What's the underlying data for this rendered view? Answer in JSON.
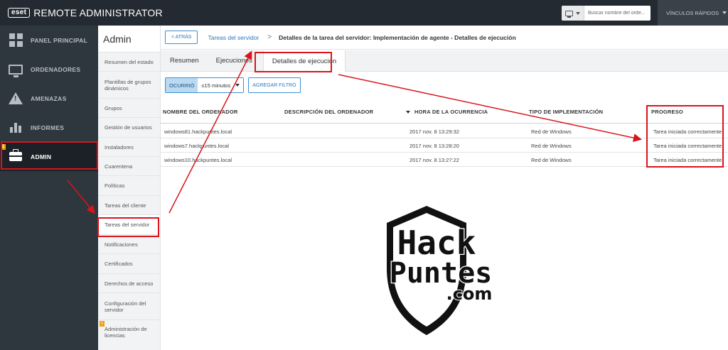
{
  "topbar": {
    "logo_text": "eset",
    "app_title": "REMOTE ADMINISTRATOR",
    "search_placeholder": "Buscar nombre del orde...",
    "quicklinks_label": "VÍNCULOS RÁPIDOS"
  },
  "leftnav": {
    "items": [
      {
        "label": "PANEL PRINCIPAL",
        "icon": "dashboard-icon"
      },
      {
        "label": "ORDENADORES",
        "icon": "computer-icon"
      },
      {
        "label": "AMENAZAS",
        "icon": "threat-icon"
      },
      {
        "label": "INFORMES",
        "icon": "reports-icon"
      },
      {
        "label": "ADMIN",
        "icon": "briefcase-icon",
        "badge": "1"
      }
    ]
  },
  "subnav": {
    "title": "Admin",
    "items": [
      "Resumen del estado",
      "Plantillas de grupos dinámicos",
      "Grupos",
      "Gestión de usuarios",
      "Instaladores",
      "Cuarentena",
      "Políticas",
      "Tareas del cliente",
      "Tareas del servidor",
      "Notificaciones",
      "Certificados",
      "Derechos de acceso",
      "Configuración del servidor",
      "Administración de licencias"
    ],
    "licencias_badge": "!"
  },
  "breadcrumb": {
    "back_label": "< ATRÁS",
    "parent": "Tareas del servidor",
    "separator": ">",
    "current": "Detalles de la tarea del servidor: Implementación de agente - Detalles de ejecución"
  },
  "tabs": [
    "Resumen",
    "Ejecuciones",
    "Detalles de ejecución"
  ],
  "filter": {
    "label": "OCURRIÓ",
    "value": "≤15 minutos",
    "add_label": "AGREGAR FILTRO"
  },
  "table": {
    "columns": [
      "NOMBRE DEL ORDENADOR",
      "DESCRIPCIÓN DEL ORDENADOR",
      "HORA DE LA OCURRENCIA",
      "TIPO DE IMPLEMENTACIÓN",
      "PROGRESO"
    ],
    "rows": [
      {
        "name": "windows81.hackpuntes.local",
        "description": "",
        "time": "2017 nov. 8 13:29:32",
        "type": "Red de Windows",
        "progress": "Tarea iniciada correctamente"
      },
      {
        "name": "windows7.hackpuntes.local",
        "description": "",
        "time": "2017 nov. 8 13:28:20",
        "type": "Red de Windows",
        "progress": "Tarea iniciada correctamente"
      },
      {
        "name": "windows10.hackpuntes.local",
        "description": "",
        "time": "2017 nov. 8 13:27:22",
        "type": "Red de Windows",
        "progress": "Tarea iniciada correctamente"
      }
    ]
  },
  "watermark": {
    "line1": "Hack",
    "line2": "Puntes",
    "line3": ".com"
  },
  "colors": {
    "topbar_bg": "#232a31",
    "leftnav_bg": "#2e363e",
    "accent_blue": "#2b78c2",
    "highlight_red": "#d9141b",
    "badge_orange": "#f0a10f"
  }
}
